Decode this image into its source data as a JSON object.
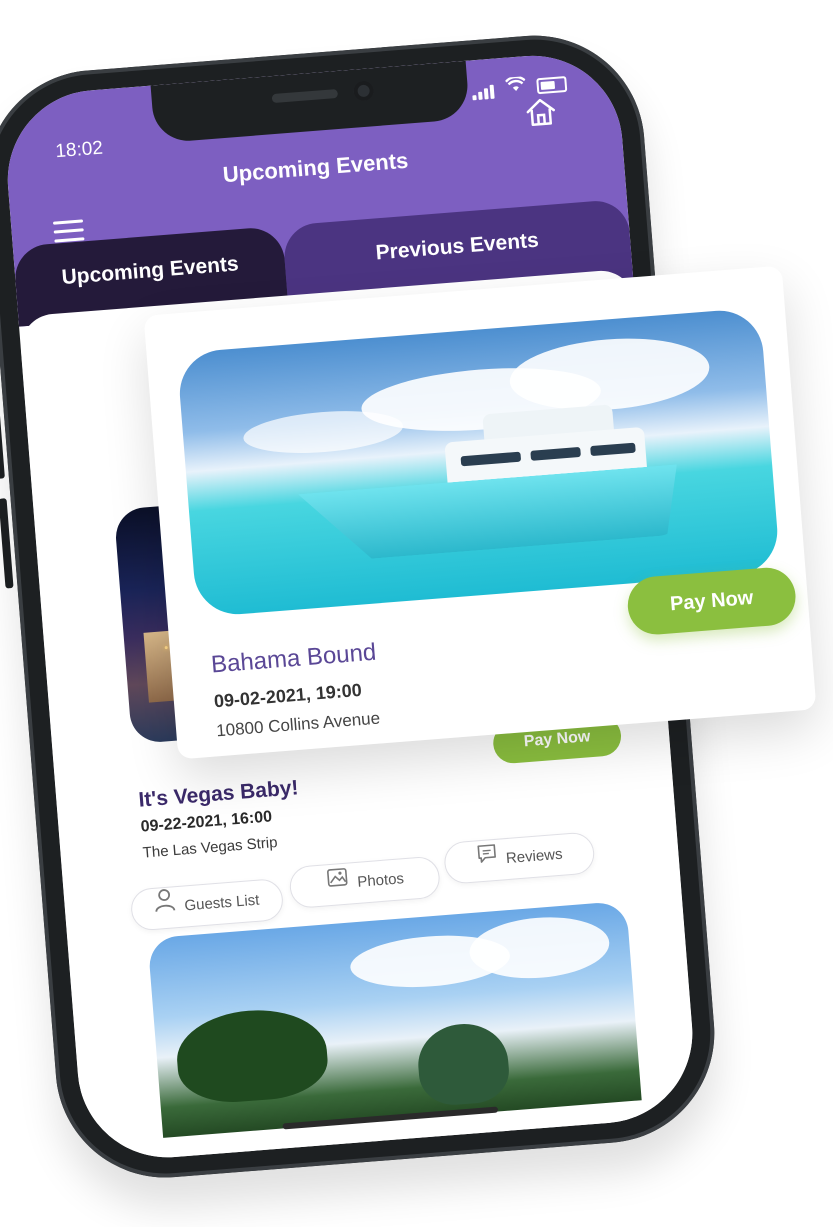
{
  "status_bar": {
    "time": "18:02"
  },
  "header": {
    "title": "Upcoming Events"
  },
  "tabs": [
    {
      "label": "Upcoming Events"
    },
    {
      "label": "Previous Events"
    }
  ],
  "featured_event": {
    "title": "Bahama Bound",
    "datetime": "09-02-2021, 19:00",
    "location": "10800 Collins Avenue",
    "pay_label": "Pay Now"
  },
  "events": [
    {
      "title": "It's Vegas Baby!",
      "datetime": "09-22-2021, 16:00",
      "location": "The Las Vegas Strip",
      "pay_label": "Pay Now",
      "actions": [
        {
          "label": "Guests List",
          "icon": "user-icon"
        },
        {
          "label": "Photos",
          "icon": "photos-icon"
        },
        {
          "label": "Reviews",
          "icon": "reviews-icon"
        }
      ]
    }
  ],
  "colors": {
    "header_purple": "#7d5fc1",
    "tab_dark": "#241a3a",
    "tab_previous": "#4b3481",
    "pay_green": "#8bbf3f",
    "title_purple": "#5a4796"
  }
}
